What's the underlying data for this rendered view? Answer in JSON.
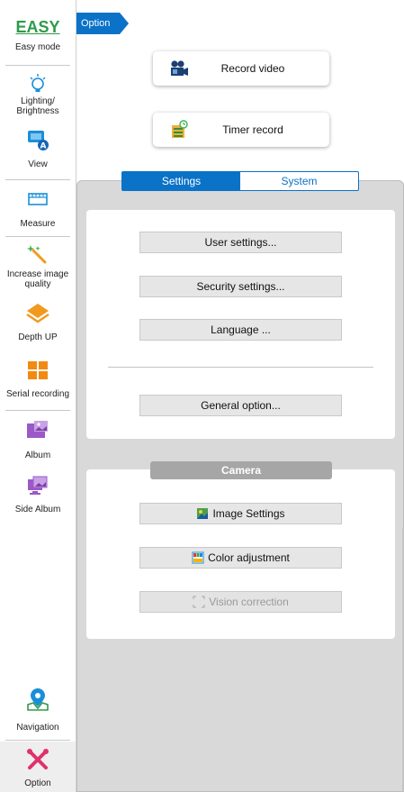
{
  "sidebar": {
    "items": [
      {
        "label": "Easy mode",
        "logo": "EASY",
        "icon": "easy-logo"
      },
      {
        "label": "Lighting/\nBrightness",
        "icon": "bulb-icon"
      },
      {
        "label": "View",
        "icon": "view-monitor-icon"
      },
      {
        "label": "Measure",
        "icon": "ruler-icon"
      },
      {
        "label": "Increase image quality",
        "icon": "magic-wand-icon"
      },
      {
        "label": "Depth UP",
        "icon": "layers-icon"
      },
      {
        "label": "Serial recording",
        "icon": "grid-icon"
      },
      {
        "label": "Album",
        "icon": "folder-image-icon"
      },
      {
        "label": "Side Album",
        "icon": "monitor-image-icon"
      },
      {
        "label": "Navigation",
        "icon": "map-pin-icon"
      },
      {
        "label": "Option",
        "icon": "tools-icon"
      }
    ]
  },
  "option_tab": {
    "label": "Option"
  },
  "actions": {
    "record_video": "Record video",
    "timer_record": "Timer record"
  },
  "tabs": [
    {
      "label": "Settings",
      "active": true
    },
    {
      "label": "System",
      "active": false
    }
  ],
  "settings_card": {
    "user_settings": "User settings...",
    "security_settings": "Security settings...",
    "language": "Language ...",
    "general_option": "General option..."
  },
  "camera_card": {
    "title": "Camera",
    "image_settings": "Image Settings",
    "color_adjustment": "Color adjustment",
    "vision_correction": "Vision correction"
  },
  "colors": {
    "accent": "#0a72c7",
    "easy_green": "#2e9a49",
    "option_pink": "#e0316b",
    "panel_grey": "#d9d9d9"
  }
}
